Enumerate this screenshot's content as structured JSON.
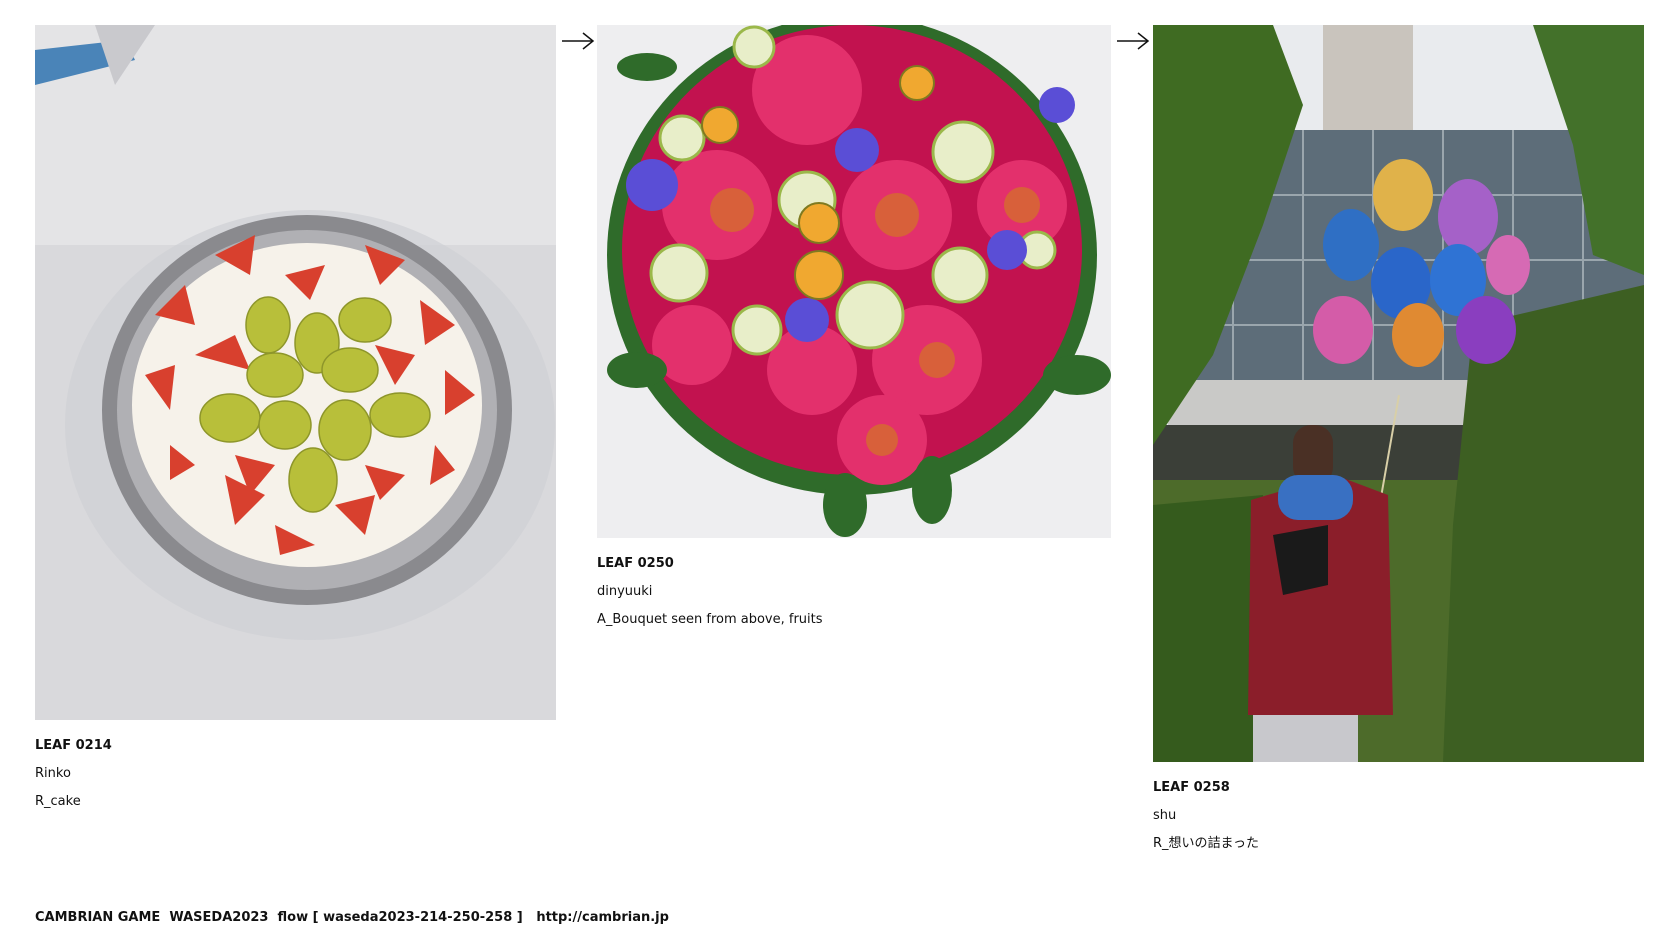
{
  "leaves": [
    {
      "id": "LEAF 0214",
      "author": "Rinko",
      "title": "R_cake",
      "image_alt": "Photo of a cake topped with strawberries and green grapes in a round foil pan"
    },
    {
      "id": "LEAF 0250",
      "author": "dinyuuki",
      "title": "A_Bouquet seen from above, fruits",
      "image_alt": "Bouquet of flowers and sliced fruits seen from above"
    },
    {
      "id": "LEAF 0258",
      "author": "shu",
      "title": "R_想いの詰まった",
      "image_alt": "Person in red jacket holding colorful balloons in front of a building"
    }
  ],
  "arrows": [
    "→",
    "→"
  ],
  "footer": {
    "text": "CAMBRIAN GAME  WASEDA2023  flow [ waseda2023-214-250-258 ]   ",
    "link": "http://cambrian.jp"
  }
}
